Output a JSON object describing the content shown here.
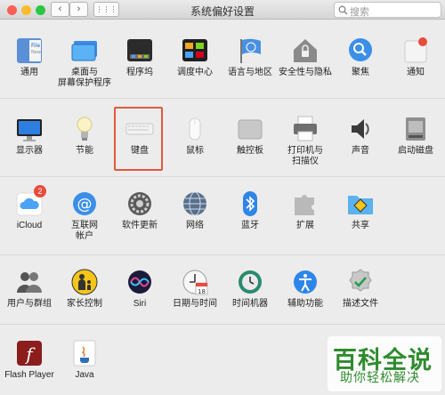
{
  "window": {
    "title": "系统偏好设置",
    "back_glyph": "‹",
    "forward_glyph": "›",
    "grid_glyph": "⋮⋮⋮",
    "search_placeholder": "搜索"
  },
  "rows": [
    [
      {
        "name": "general",
        "label": "通用",
        "icon": "general-icon"
      },
      {
        "name": "desktop-screensaver",
        "label": "桌面与\n屏幕保护程序",
        "icon": "desktop-icon"
      },
      {
        "name": "dock",
        "label": "程序坞",
        "icon": "dock-icon"
      },
      {
        "name": "mission-control",
        "label": "调度中心",
        "icon": "mission-control-icon"
      },
      {
        "name": "language-region",
        "label": "语言与地区",
        "icon": "flag-icon"
      },
      {
        "name": "security-privacy",
        "label": "安全性与隐私",
        "icon": "house-lock-icon"
      },
      {
        "name": "spotlight",
        "label": "聚焦",
        "icon": "magnifier-icon"
      },
      {
        "name": "notifications",
        "label": "通知",
        "icon": "notification-icon"
      }
    ],
    [
      {
        "name": "displays",
        "label": "显示器",
        "icon": "display-icon"
      },
      {
        "name": "energy-saver",
        "label": "节能",
        "icon": "bulb-icon"
      },
      {
        "name": "keyboard",
        "label": "键盘",
        "icon": "keyboard-icon"
      },
      {
        "name": "mouse",
        "label": "鼠标",
        "icon": "mouse-icon"
      },
      {
        "name": "trackpad",
        "label": "触控板",
        "icon": "trackpad-icon"
      },
      {
        "name": "printers-scanners",
        "label": "打印机与\n扫描仪",
        "icon": "printer-icon"
      },
      {
        "name": "sound",
        "label": "声音",
        "icon": "speaker-icon"
      },
      {
        "name": "startup-disk",
        "label": "启动磁盘",
        "icon": "disk-icon"
      }
    ],
    [
      {
        "name": "icloud",
        "label": "iCloud",
        "icon": "cloud-icon",
        "badge": "2"
      },
      {
        "name": "internet-accounts",
        "label": "互联网\n帐户",
        "icon": "at-icon"
      },
      {
        "name": "software-update",
        "label": "软件更新",
        "icon": "gear-icon"
      },
      {
        "name": "network",
        "label": "网络",
        "icon": "globe-icon"
      },
      {
        "name": "bluetooth",
        "label": "蓝牙",
        "icon": "bluetooth-icon"
      },
      {
        "name": "extensions",
        "label": "扩展",
        "icon": "puzzle-icon"
      },
      {
        "name": "sharing",
        "label": "共享",
        "icon": "folder-sign-icon"
      }
    ],
    [
      {
        "name": "users-groups",
        "label": "用户与群组",
        "icon": "users-icon"
      },
      {
        "name": "parental-controls",
        "label": "家长控制",
        "icon": "parental-icon"
      },
      {
        "name": "siri",
        "label": "Siri",
        "icon": "siri-icon"
      },
      {
        "name": "date-time",
        "label": "日期与时间",
        "icon": "calendar-clock-icon",
        "day": "18"
      },
      {
        "name": "time-machine",
        "label": "时间机器",
        "icon": "time-machine-icon"
      },
      {
        "name": "accessibility",
        "label": "辅助功能",
        "icon": "accessibility-icon"
      },
      {
        "name": "profiles",
        "label": "描述文件",
        "icon": "checkmark-badge-icon"
      }
    ],
    [
      {
        "name": "flash-player",
        "label": "Flash Player",
        "icon": "flash-icon",
        "glyph": "f"
      },
      {
        "name": "java",
        "label": "Java",
        "icon": "java-icon"
      }
    ]
  ],
  "watermark": {
    "title": "百科全说",
    "subtitle": "助你轻松解决"
  },
  "colors": {
    "close": "#fd5f57",
    "minimize": "#fdbc2e",
    "zoom": "#28c840",
    "highlight": "#e05a3c",
    "watermark": "#2e8b2e"
  }
}
